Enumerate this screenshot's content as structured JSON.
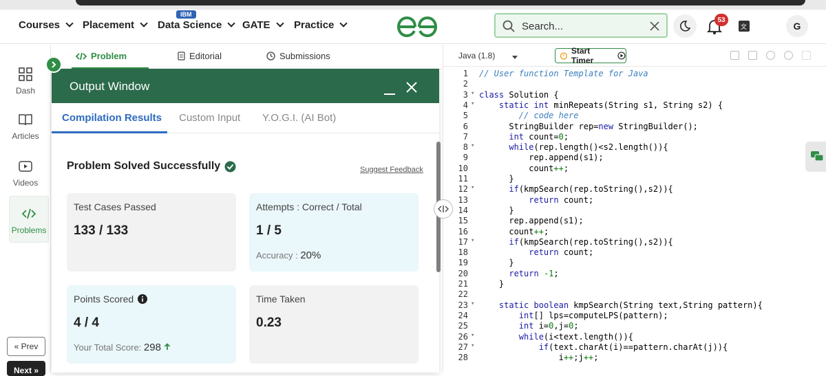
{
  "nav": {
    "items": [
      "Courses",
      "Placement",
      "Data Science",
      "GATE",
      "Practice"
    ],
    "ibm_badge": "IBM",
    "search_placeholder": "Search...",
    "notifications_count": "53",
    "avatar_letter": "G",
    "brand_color": "#2f8d46"
  },
  "sidebar": {
    "items": [
      {
        "label": "Dash",
        "icon": "grid-icon"
      },
      {
        "label": "Articles",
        "icon": "book-icon"
      },
      {
        "label": "Videos",
        "icon": "play-icon"
      },
      {
        "label": "Problems",
        "icon": "code-icon"
      }
    ],
    "prev_label": "« Prev",
    "next_label": "Next »"
  },
  "problem_tabs": [
    "Problem",
    "Editorial",
    "Submissions"
  ],
  "output": {
    "title": "Output Window",
    "tabs": [
      "Compilation Results",
      "Custom Input",
      "Y.O.G.I. (AI Bot)"
    ],
    "status": "Problem Solved Successfully",
    "feedback": "Suggest Feedback",
    "cards": {
      "test_cases_label": "Test Cases Passed",
      "test_cases_value": "133 / 133",
      "attempts_label": "Attempts : Correct / Total",
      "attempts_value": "1 / 5",
      "accuracy_label": "Accuracy :",
      "accuracy_value": "20%",
      "points_label": "Points Scored",
      "points_value": "4 / 4",
      "total_score_label": "Your Total Score:",
      "total_score_value": "298",
      "time_label": "Time Taken",
      "time_value": "0.23"
    }
  },
  "editor": {
    "language": "Java (1.8)",
    "timer_label": "Start Timer",
    "lines": [
      "// User function Template for Java",
      "",
      "class Solution {",
      "    static int minRepeats(String s1, String s2) {",
      "        // code here",
      "      StringBuilder rep=new StringBuilder();",
      "      int count=0;",
      "      while(rep.length()<s2.length()){",
      "          rep.append(s1);",
      "          count++;",
      "      }",
      "      if(kmpSearch(rep.toString(),s2)){",
      "          return count;",
      "      }",
      "      rep.append(s1);",
      "      count++;",
      "      if(kmpSearch(rep.toString(),s2)){",
      "          return count;",
      "      }",
      "      return -1;",
      "    }",
      "",
      "    static boolean kmpSearch(String text,String pattern){",
      "        int[] lps=computeLPS(pattern);",
      "        int i=0,j=0;",
      "        while(i<text.length()){",
      "            if(text.charAt(i)==pattern.charAt(j)){",
      "                i++;j++;"
    ],
    "fold_lines": [
      3,
      4,
      8,
      12,
      17,
      23,
      26,
      27
    ]
  }
}
